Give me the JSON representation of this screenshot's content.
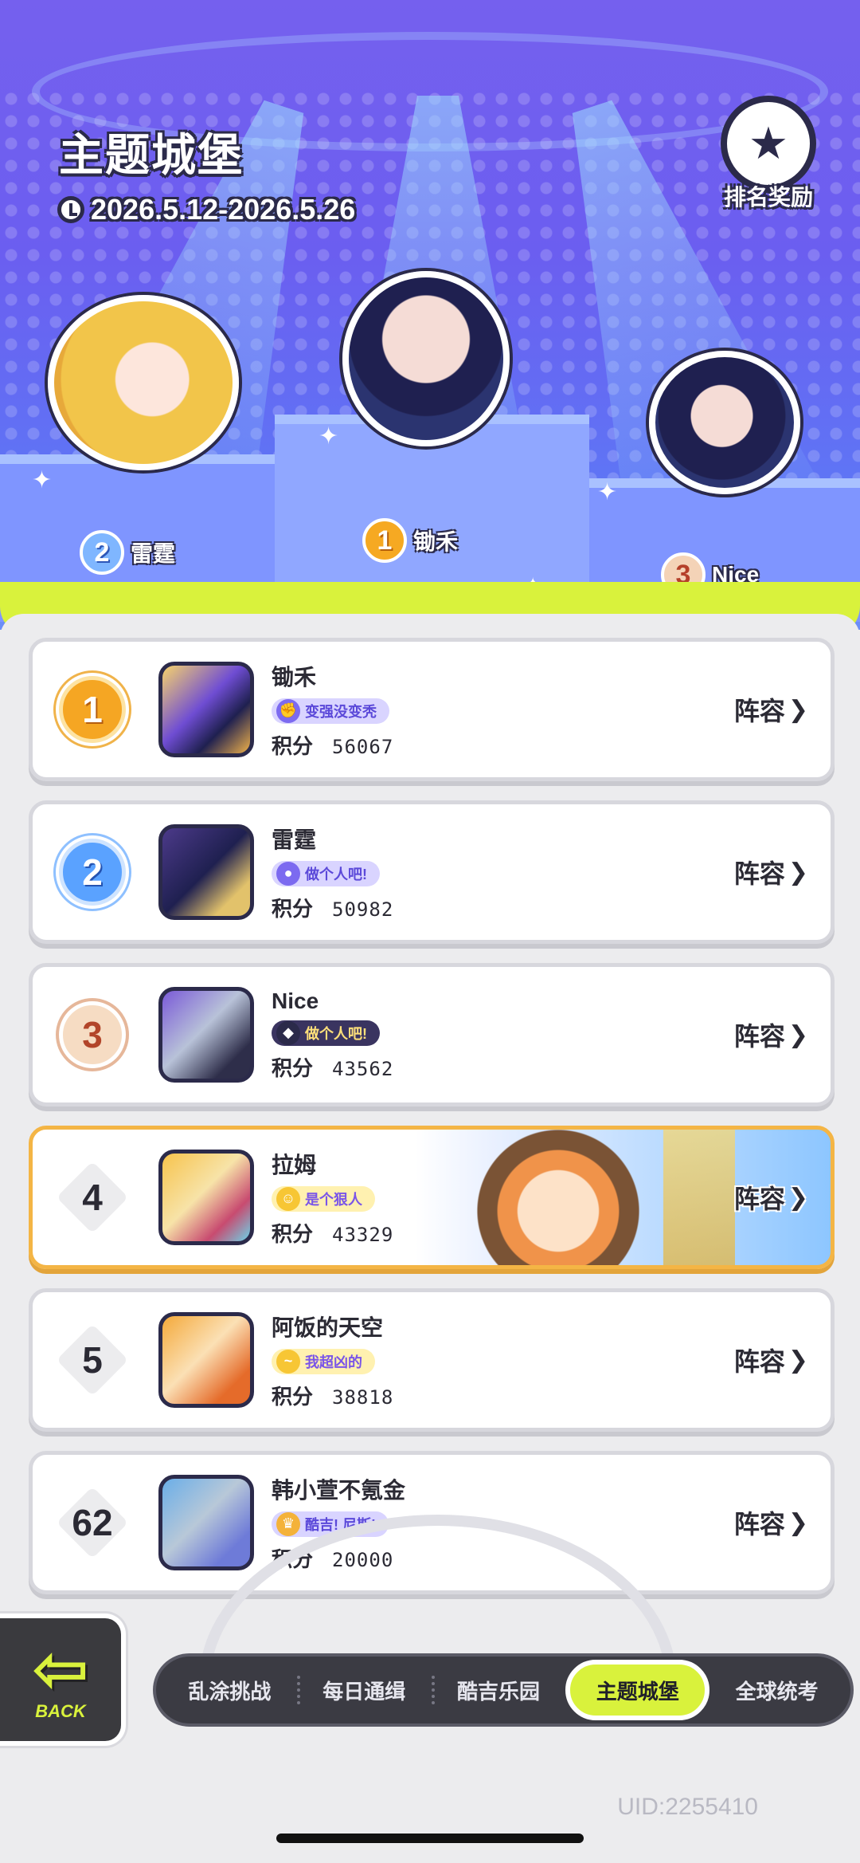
{
  "header": {
    "title": "主题城堡",
    "date_range": "2026.5.12-2026.5.26",
    "reward_label": "排名奖励"
  },
  "podium": [
    {
      "rank": "1",
      "name": "锄禾"
    },
    {
      "rank": "2",
      "name": "雷霆"
    },
    {
      "rank": "3",
      "name": "Nice"
    }
  ],
  "leaderboard": {
    "score_label": "积分",
    "lineup_label": "阵容",
    "rows": [
      {
        "rank": "1",
        "name": "锄禾",
        "tag": "变强没变秃",
        "score": "56067"
      },
      {
        "rank": "2",
        "name": "雷霆",
        "tag": "做个人吧!",
        "score": "50982"
      },
      {
        "rank": "3",
        "name": "Nice",
        "tag": "做个人吧!",
        "score": "43562"
      },
      {
        "rank": "4",
        "name": "拉姆",
        "tag": "是个狠人",
        "score": "43329"
      },
      {
        "rank": "5",
        "name": "阿饭的天空",
        "tag": "我超凶的",
        "score": "38818"
      },
      {
        "rank": "62",
        "name": "韩小萱不氪金",
        "tag": "酷吉! 尼斯!",
        "score": "20000"
      }
    ]
  },
  "nav": {
    "back_label": "BACK",
    "tabs": [
      "乱涂挑战",
      "每日通缉",
      "酷吉乐园",
      "主题城堡",
      "全球统考"
    ],
    "active_tab": "主题城堡"
  },
  "uid": "UID:2255410",
  "colors": {
    "accent_lime": "#d9f23c",
    "hero_purple": "#6b5ef0",
    "highlight_row_border": "#f4b545",
    "gold": "#f5a623",
    "silver": "#5aa2ff",
    "bronze": "#f6dcc3"
  }
}
